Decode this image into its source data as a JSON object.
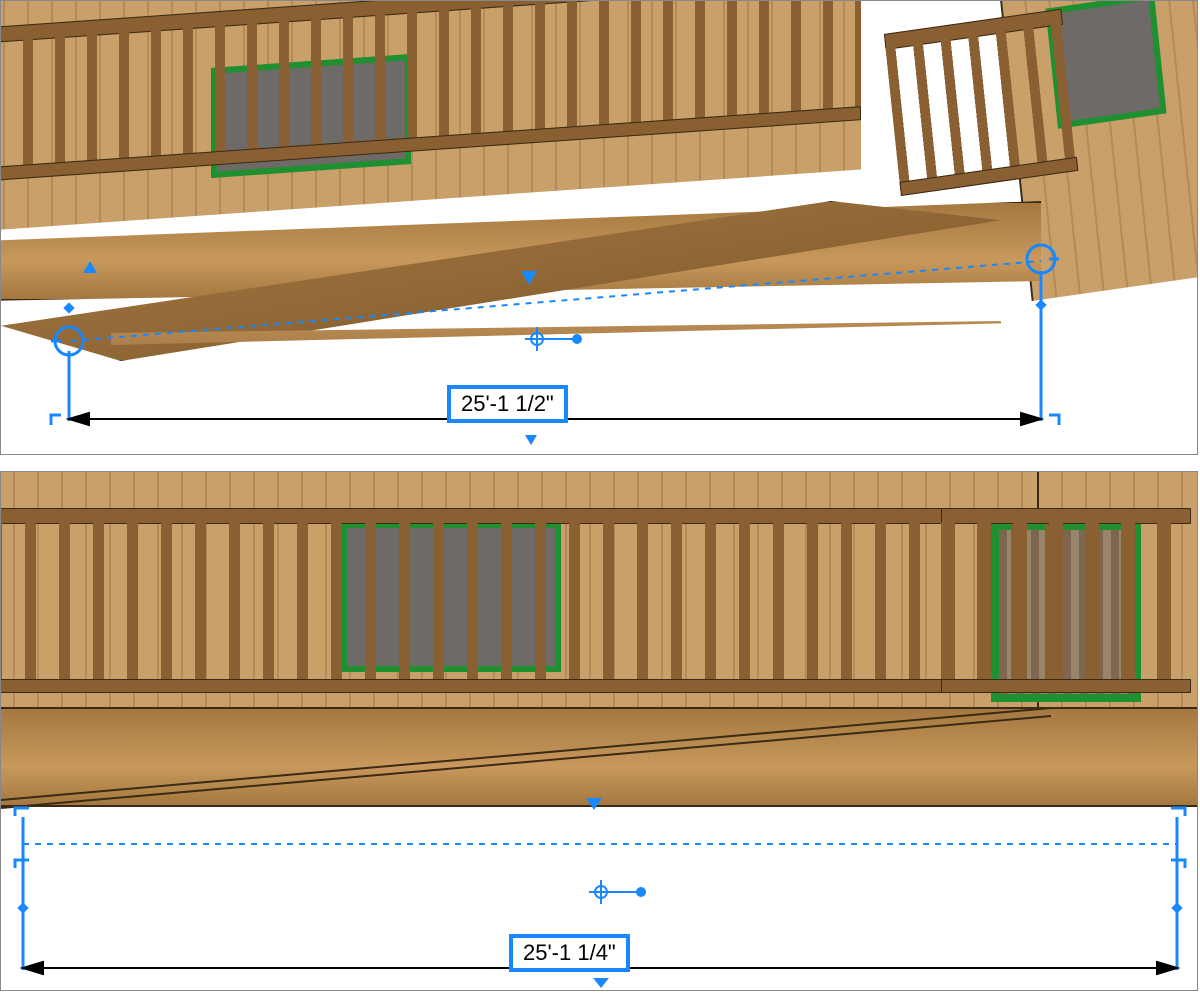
{
  "colors": {
    "selection": "#1988ff",
    "window_frame": "#1f9030",
    "wood_light": "#c9a06a",
    "wood_dark": "#8a5f31"
  },
  "top_view": {
    "type": "perspective",
    "selected_object": "ramp",
    "dimension_value": "25'-1 1/2\"",
    "dimension_editable": true
  },
  "bottom_view": {
    "type": "elevation",
    "selected_object": "ramp",
    "dimension_value": "25'-1 1/4\"",
    "dimension_editable": true
  }
}
